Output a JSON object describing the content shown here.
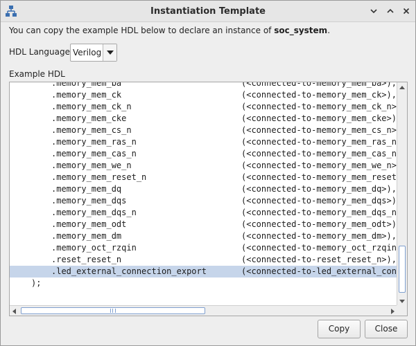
{
  "window": {
    "title": "Instantiation Template",
    "icon": "network-hierarchy-icon",
    "controls": [
      "chevron-down-icon",
      "chevron-up-icon",
      "close-icon"
    ]
  },
  "description": {
    "prefix": "You can copy the example HDL below to declare an instance of ",
    "entity": "soc_system",
    "suffix": "."
  },
  "hdl_language": {
    "label": "HDL Language:",
    "selected": "Verilog"
  },
  "example_hdl": {
    "label": "Example HDL",
    "lines": [
      {
        "port": ".memory_mem_ba",
        "connection": "(<connected-to-memory_mem_ba>),"
      },
      {
        "port": ".memory_mem_ck",
        "connection": "(<connected-to-memory_mem_ck>),"
      },
      {
        "port": ".memory_mem_ck_n",
        "connection": "(<connected-to-memory_mem_ck_n>)"
      },
      {
        "port": ".memory_mem_cke",
        "connection": "(<connected-to-memory_mem_cke>),"
      },
      {
        "port": ".memory_mem_cs_n",
        "connection": "(<connected-to-memory_mem_cs_n>)"
      },
      {
        "port": ".memory_mem_ras_n",
        "connection": "(<connected-to-memory_mem_ras_n>"
      },
      {
        "port": ".memory_mem_cas_n",
        "connection": "(<connected-to-memory_mem_cas_n>"
      },
      {
        "port": ".memory_mem_we_n",
        "connection": "(<connected-to-memory_mem_we_n>)"
      },
      {
        "port": ".memory_mem_reset_n",
        "connection": "(<connected-to-memory_mem_reset_n"
      },
      {
        "port": ".memory_mem_dq",
        "connection": "(<connected-to-memory_mem_dq>),"
      },
      {
        "port": ".memory_mem_dqs",
        "connection": "(<connected-to-memory_mem_dqs>),"
      },
      {
        "port": ".memory_mem_dqs_n",
        "connection": "(<connected-to-memory_mem_dqs_n>)"
      },
      {
        "port": ".memory_mem_odt",
        "connection": "(<connected-to-memory_mem_odt>),"
      },
      {
        "port": ".memory_mem_dm",
        "connection": "(<connected-to-memory_mem_dm>),"
      },
      {
        "port": ".memory_oct_rzqin",
        "connection": "(<connected-to-memory_oct_rzqin>"
      },
      {
        "port": ".reset_reset_n",
        "connection": "(<connected-to-reset_reset_n>),"
      },
      {
        "port": ".led_external_connection_export",
        "connection": "(<connected-to-led_external_conne"
      }
    ],
    "selected_line": 16,
    "closing": ");"
  },
  "buttons": {
    "copy": "Copy",
    "close": "Close"
  }
}
